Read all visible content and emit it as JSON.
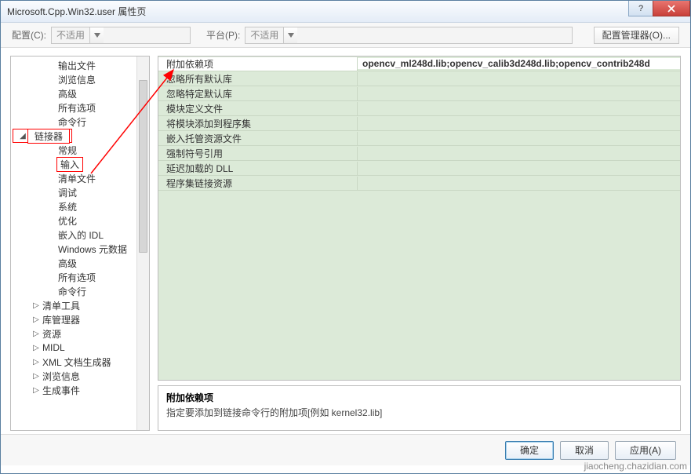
{
  "window": {
    "title": "Microsoft.Cpp.Win32.user 属性页"
  },
  "toolbar": {
    "config_label": "配置(C):",
    "config_value": "不适用",
    "platform_label": "平台(P):",
    "platform_value": "不适用",
    "config_manager": "配置管理器(O)..."
  },
  "tree": {
    "items": [
      {
        "label": "输出文件",
        "depth": 2,
        "toggle": ""
      },
      {
        "label": "浏览信息",
        "depth": 2,
        "toggle": ""
      },
      {
        "label": "高级",
        "depth": 2,
        "toggle": ""
      },
      {
        "label": "所有选项",
        "depth": 2,
        "toggle": ""
      },
      {
        "label": "命令行",
        "depth": 2,
        "toggle": ""
      },
      {
        "label": "链接器",
        "depth": 1,
        "toggle": "▲",
        "hl": true
      },
      {
        "label": "常规",
        "depth": 2,
        "toggle": ""
      },
      {
        "label": "输入",
        "depth": 2,
        "toggle": "",
        "selected": true
      },
      {
        "label": "清单文件",
        "depth": 2,
        "toggle": ""
      },
      {
        "label": "调试",
        "depth": 2,
        "toggle": ""
      },
      {
        "label": "系统",
        "depth": 2,
        "toggle": ""
      },
      {
        "label": "优化",
        "depth": 2,
        "toggle": ""
      },
      {
        "label": "嵌入的 IDL",
        "depth": 2,
        "toggle": ""
      },
      {
        "label": "Windows 元数据",
        "depth": 2,
        "toggle": ""
      },
      {
        "label": "高级",
        "depth": 2,
        "toggle": ""
      },
      {
        "label": "所有选项",
        "depth": 2,
        "toggle": ""
      },
      {
        "label": "命令行",
        "depth": 2,
        "toggle": ""
      },
      {
        "label": "清单工具",
        "depth": 1,
        "toggle": "▷"
      },
      {
        "label": "库管理器",
        "depth": 1,
        "toggle": "▷"
      },
      {
        "label": "资源",
        "depth": 1,
        "toggle": "▷"
      },
      {
        "label": "MIDL",
        "depth": 1,
        "toggle": "▷"
      },
      {
        "label": "XML 文档生成器",
        "depth": 1,
        "toggle": "▷"
      },
      {
        "label": "浏览信息",
        "depth": 1,
        "toggle": "▷"
      },
      {
        "label": "生成事件",
        "depth": 1,
        "toggle": "▷"
      }
    ]
  },
  "grid": {
    "rows": [
      {
        "label": "附加依赖项",
        "value": "opencv_ml248d.lib;opencv_calib3d248d.lib;opencv_contrib248d",
        "active": true
      },
      {
        "label": "忽略所有默认库",
        "value": ""
      },
      {
        "label": "忽略特定默认库",
        "value": ""
      },
      {
        "label": "模块定义文件",
        "value": ""
      },
      {
        "label": "将模块添加到程序集",
        "value": ""
      },
      {
        "label": "嵌入托管资源文件",
        "value": ""
      },
      {
        "label": "强制符号引用",
        "value": ""
      },
      {
        "label": "延迟加载的 DLL",
        "value": ""
      },
      {
        "label": "程序集链接资源",
        "value": ""
      }
    ]
  },
  "description": {
    "title": "附加依赖项",
    "body": "指定要添加到链接命令行的附加项[例如 kernel32.lib]"
  },
  "footer": {
    "ok": "确定",
    "cancel": "取消",
    "apply": "应用(A)"
  },
  "watermark": "jiaocheng.chazidian.com"
}
